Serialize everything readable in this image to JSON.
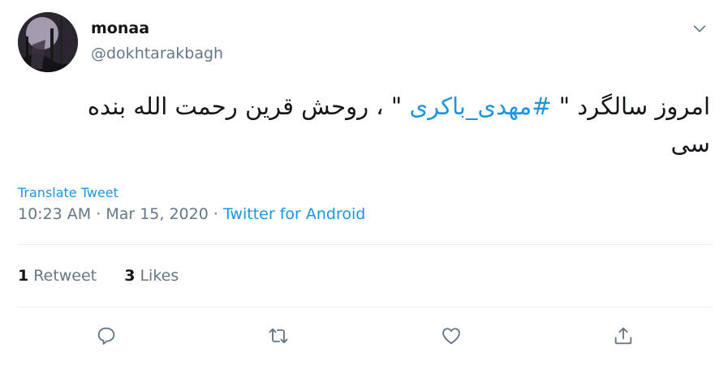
{
  "user": {
    "name": "monaa",
    "handle": "@dokhtarakbagh"
  },
  "tweet": {
    "text_before": "امروز سالگرد \" ",
    "hashtag": "#مهدی_باکری",
    "text_after": " \" ، روحش قرین رحمت الله بنده سی",
    "translate_label": "Translate Tweet",
    "time": "10:23 AM",
    "separator": "·",
    "date": "Mar 15, 2020",
    "source": "Twitter for Android"
  },
  "stats": {
    "retweets_count": "1",
    "retweets_label": "Retweet",
    "likes_count": "3",
    "likes_label": "Likes"
  },
  "colors": {
    "link": "#1b95e0",
    "secondary": "#657786",
    "icon": "#657786"
  },
  "icons": {
    "caret": "chevron-down-icon",
    "reply": "reply-icon",
    "retweet": "retweet-icon",
    "like": "heart-icon",
    "share": "share-icon"
  }
}
